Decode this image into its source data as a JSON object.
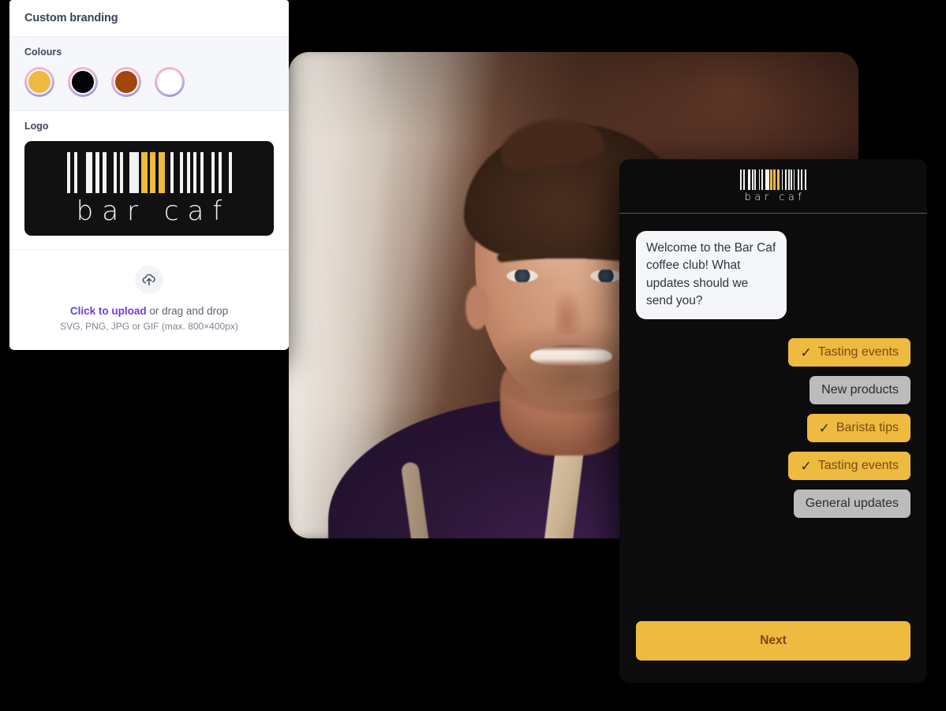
{
  "branding_panel": {
    "header_title": "Custom branding",
    "colours_label": "Colours",
    "swatches": [
      {
        "name": "gold",
        "hex": "#eeba3f"
      },
      {
        "name": "black",
        "hex": "#050505"
      },
      {
        "name": "brown",
        "hex": "#a4450b"
      },
      {
        "name": "white",
        "hex": "#ffffff"
      }
    ],
    "logo_label": "Logo",
    "logo_wordmark": "bar caf",
    "upload": {
      "link_text": "Click to upload",
      "rest_text": " or drag and drop",
      "hint": "SVG, PNG, JPG or GIF (max. 800×400px)",
      "icon": "cloud-upload-icon",
      "link_color": "#6b3fe0"
    }
  },
  "chat_panel": {
    "logo_wordmark": "bar caf",
    "message": "Welcome to the Bar Caf coffee club! What updates should we send you?",
    "options": [
      {
        "label": "Tasting events",
        "selected": true,
        "tick": "✓"
      },
      {
        "label": "New products",
        "selected": false,
        "tick": ""
      },
      {
        "label": "Barista tips",
        "selected": true,
        "tick": "✓"
      },
      {
        "label": "Tasting events",
        "selected": true,
        "tick": "✓"
      },
      {
        "label": "General updates",
        "selected": false,
        "tick": ""
      }
    ],
    "next_label": "Next",
    "accent_color": "#eeba3f",
    "accent_text_color": "#7a4512",
    "unselected_color": "#bcbcbc"
  },
  "photo_card": {
    "alt": "Smiling barista in a purple t-shirt wearing an apron inside a cafe",
    "name": "barista-portrait-photo"
  },
  "barcode_pattern": [
    {
      "w": 4,
      "c": "#f1f2f6"
    },
    {
      "w": 5,
      "c": "#111111"
    },
    {
      "w": 4,
      "c": "#f1f2f6"
    },
    {
      "w": 11,
      "c": "#111111"
    },
    {
      "w": 8,
      "c": "#f1f2f6"
    },
    {
      "w": 4,
      "c": "#111111"
    },
    {
      "w": 5,
      "c": "#f1f2f6"
    },
    {
      "w": 4,
      "c": "#111111"
    },
    {
      "w": 5,
      "c": "#f1f2f6"
    },
    {
      "w": 9,
      "c": "#111111"
    },
    {
      "w": 4,
      "c": "#f1f2f6"
    },
    {
      "w": 4,
      "c": "#111111"
    },
    {
      "w": 4,
      "c": "#f1f2f6"
    },
    {
      "w": 8,
      "c": "#111111"
    },
    {
      "w": 12,
      "c": "#f1f2f6"
    },
    {
      "w": 3,
      "c": "#111111"
    },
    {
      "w": 8,
      "c": "#eeba3f"
    },
    {
      "w": 3,
      "c": "#111111"
    },
    {
      "w": 7,
      "c": "#eeba3f"
    },
    {
      "w": 4,
      "c": "#111111"
    },
    {
      "w": 8,
      "c": "#eeba3f"
    },
    {
      "w": 7,
      "c": "#111111"
    },
    {
      "w": 4,
      "c": "#f1f2f6"
    },
    {
      "w": 8,
      "c": "#111111"
    },
    {
      "w": 4,
      "c": "#f1f2f6"
    },
    {
      "w": 5,
      "c": "#111111"
    },
    {
      "w": 4,
      "c": "#f1f2f6"
    },
    {
      "w": 4,
      "c": "#111111"
    },
    {
      "w": 4,
      "c": "#f1f2f6"
    },
    {
      "w": 5,
      "c": "#111111"
    },
    {
      "w": 4,
      "c": "#f1f2f6"
    },
    {
      "w": 10,
      "c": "#111111"
    },
    {
      "w": 4,
      "c": "#f1f2f6"
    },
    {
      "w": 5,
      "c": "#111111"
    },
    {
      "w": 4,
      "c": "#f1f2f6"
    },
    {
      "w": 9,
      "c": "#111111"
    },
    {
      "w": 4,
      "c": "#f1f2f6"
    }
  ]
}
